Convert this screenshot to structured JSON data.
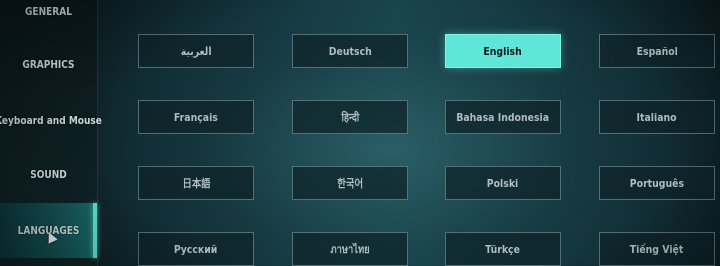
{
  "sidebar": {
    "items": [
      {
        "label": "GENERAL"
      },
      {
        "label": "GRAPHICS"
      },
      {
        "label": "Keyboard and Mouse"
      },
      {
        "label": "SOUND"
      },
      {
        "label": "LANGUAGES"
      }
    ],
    "active": "LANGUAGES",
    "accent_color": "#5fe8d7"
  },
  "languages": {
    "selected": "English",
    "options": [
      {
        "label": "العربية"
      },
      {
        "label": "Deutsch"
      },
      {
        "label": "English"
      },
      {
        "label": "Español"
      },
      {
        "label": "Français"
      },
      {
        "label": "हिन्दी"
      },
      {
        "label": "Bahasa Indonesia"
      },
      {
        "label": "Italiano"
      },
      {
        "label": "日本語"
      },
      {
        "label": "한국어"
      },
      {
        "label": "Polski"
      },
      {
        "label": "Português"
      },
      {
        "label": "Русский"
      },
      {
        "label": "ภาษาไทย"
      },
      {
        "label": "Türkçe"
      },
      {
        "label": "Tiếng Việt"
      }
    ]
  },
  "colors": {
    "selected_bg": "#5fe6d6",
    "button_border": "#8caab0",
    "background": "#17414a"
  },
  "icons": {
    "cursor": "mouse-pointer-icon"
  }
}
